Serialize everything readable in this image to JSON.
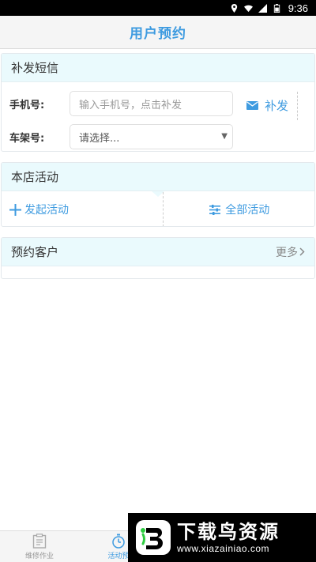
{
  "status_bar": {
    "time": "9:36"
  },
  "app_bar": {
    "title": "用户预约"
  },
  "sms_card": {
    "title": "补发短信",
    "phone_label": "手机号:",
    "phone_placeholder": "输入手机号，点击补发",
    "frame_label": "车架号:",
    "frame_select_value": "请选择...",
    "resend_label": "补发"
  },
  "activity_card": {
    "title": "本店活动",
    "create_label": "发起活动",
    "all_label": "全部活动"
  },
  "clients_card": {
    "title": "预约客户",
    "more_label": "更多"
  },
  "tab_bar": {
    "tabs": [
      {
        "label": "维修作业",
        "icon": "clipboard-icon"
      },
      {
        "label": "活动预",
        "icon": "stopwatch-icon"
      }
    ]
  },
  "watermark": {
    "title": "下载鸟资源",
    "url": "www.xiazainiao.com"
  },
  "colors": {
    "accent": "#3e9be0",
    "card_header_bg": "#eafafd"
  }
}
